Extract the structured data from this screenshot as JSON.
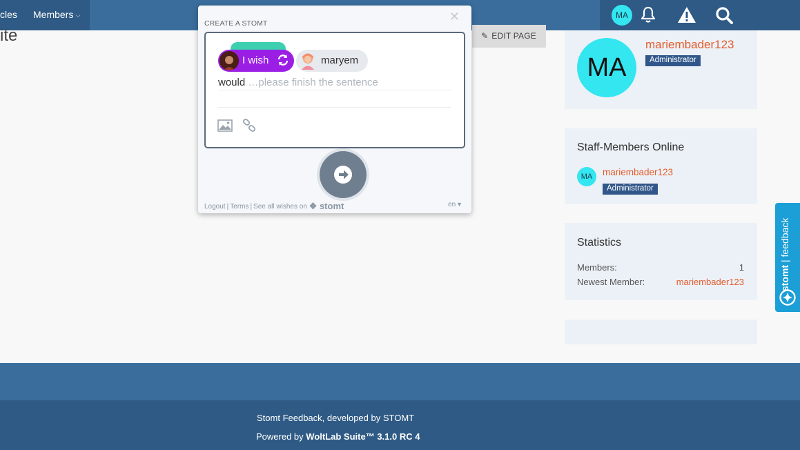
{
  "nav": {
    "articles_partial": "cles",
    "members_label": "Members",
    "user_initials": "MA"
  },
  "page": {
    "title_fragment": "ite",
    "edit_page_label": "EDIT PAGE"
  },
  "widget": {
    "title": "CREATE A STOMT",
    "wish_label": "I wish",
    "target_name": "maryem",
    "text_prefix": "would",
    "placeholder": "…please finish the sentence",
    "footer_logout": "Logout",
    "footer_terms": "Terms",
    "footer_see_all": "See all wishes on",
    "footer_brand": "stomt",
    "language": "en"
  },
  "sidebar": {
    "profile": {
      "initials": "MA",
      "name": "mariembader123",
      "role": "Administrator"
    },
    "online": {
      "title": "Staff-Members Online",
      "member_initials": "MA",
      "member_name": "mariembader123",
      "member_role": "Administrator"
    },
    "stats": {
      "title": "Statistics",
      "members_label": "Members:",
      "members_value": "1",
      "newest_label": "Newest Member:",
      "newest_value": "mariembader123"
    }
  },
  "feedback_tab": {
    "brand": "stomt",
    "label": "feedback"
  },
  "footer": {
    "line1": "Stomt Feedback, developed by STOMT",
    "powered_prefix": "Powered by",
    "powered_product": "WoltLab Suite™ 3.1.0 RC 4"
  },
  "colors": {
    "nav_bg": "#3a6d9c",
    "nav_dark": "#2e5a85",
    "accent_orange": "#e35b2a",
    "avatar_cyan": "#33e6f0",
    "wish_purple": "#9b1ee5",
    "stomt_blue": "#1b9fd6"
  }
}
